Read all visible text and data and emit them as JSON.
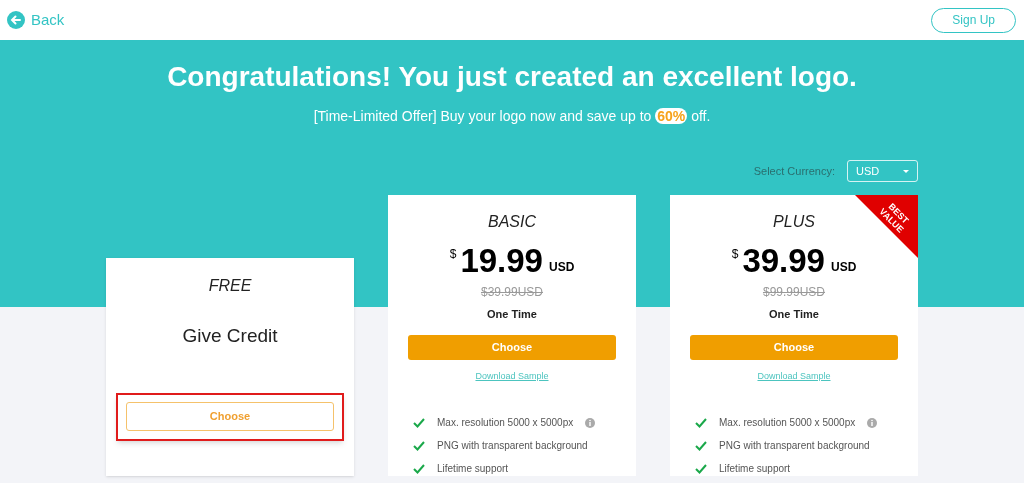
{
  "header": {
    "back_link": "Back",
    "signup_button": "Sign Up"
  },
  "hero": {
    "title": "Congratulations! You just created an excellent logo.",
    "subtitle": "[Time-Limited Offer] Buy your logo now and save up to",
    "discount": "60%",
    "subtitle_end": "off."
  },
  "currency": {
    "label": "Select Currency:",
    "value": "USD"
  },
  "plans": [
    {
      "kind": "free",
      "name": "FREE",
      "headline": "Give Credit",
      "button": "Choose",
      "highlighted": true
    },
    {
      "kind": "paid",
      "name": "BASIC",
      "currency_sign": "$",
      "price": "19.99",
      "currency": "USD",
      "old_price": "$39.99USD",
      "term": "One Time",
      "button": "Choose",
      "sample_link": "Download Sample",
      "features": [
        {
          "text": "Max. resolution 5000 x 5000px",
          "info": true
        },
        {
          "text": "PNG with transparent background",
          "info": false
        },
        {
          "text": "Lifetime support",
          "info": false
        }
      ]
    },
    {
      "kind": "paid",
      "name": "PLUS",
      "ribbon": "BEST VALUE",
      "currency_sign": "$",
      "price": "39.99",
      "currency": "USD",
      "old_price": "$99.99USD",
      "term": "One Time",
      "button": "Choose",
      "sample_link": "Download Sample",
      "features": [
        {
          "text": "Max. resolution 5000 x 5000px",
          "info": true
        },
        {
          "text": "PNG with transparent background",
          "info": false
        },
        {
          "text": "Lifetime support",
          "info": false
        }
      ]
    }
  ]
}
